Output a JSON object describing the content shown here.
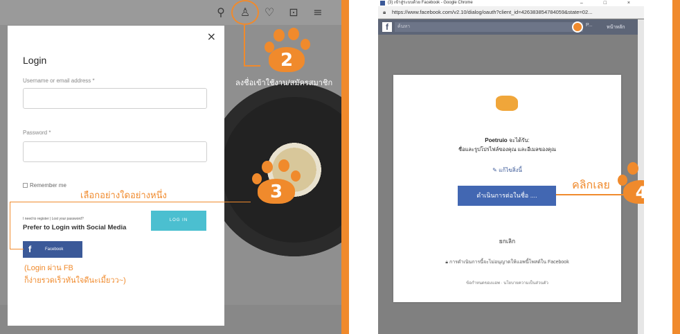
{
  "left": {
    "modal": {
      "close": "×",
      "title": "Login",
      "username_label": "Username or email address *",
      "password_label": "Password *",
      "remember_label": "Remember me",
      "login_button": "LOG IN",
      "small_links": "I need to register | Lost your password?",
      "social_title": "Prefer to Login with Social Media",
      "facebook_label": "Facebook",
      "facebook_letter": "f"
    },
    "nav_icons": [
      "search-icon",
      "user-icon",
      "heart-icon",
      "bag-icon",
      "menu-icon"
    ],
    "annotations": {
      "step2": "2",
      "step2_caption": "ลงชื่อเข้าใช้งาน/สมัครสมาชิก",
      "step3": "3",
      "step3_caption": "เลือกอย่างใดอย่างหนึ่ง",
      "fb_note_1": "(Login ผ่าน FB",
      "fb_note_2": "ก็ง่ายรวดเร็วทันใจดีนะเมี้ยวว~)"
    }
  },
  "right": {
    "window_title": "(3) เข้าสู่ระบบด้วย Facebook - Google Chrome",
    "window_controls": "– □ ×",
    "url": "https://www.facebook.com/v2.10/dialog/oauth?client_id=426383854784059&state=02...",
    "fb_search_placeholder": "ค้นหา",
    "fb_name": "P...",
    "fb_home": "หน้าหลัก",
    "dialog": {
      "app_name": "Poetruio",
      "receive": "จะได้รับ:",
      "permissions": "ชื่อและรูปโปรไฟล์ของคุณ และอีเมลของคุณ",
      "edit": "แก้ไขสิ่งนี้",
      "continue": "ดำเนินการต่อในชื่อ ....",
      "cancel": "ยกเลิก",
      "notice": "การดำเนินการนี้จะไม่อนุญาตให้แอพนี้โพสต์ใน Facebook",
      "policy": "ข้อกำหนดของแอพ · นโยบายความเป็นส่วนตัว"
    },
    "annotations": {
      "step4": "4",
      "step4_caption": "คลิกเลย"
    }
  },
  "colors": {
    "accent": "#f08a2c",
    "facebook": "#3b5998",
    "login_button": "#4bbfd0",
    "continue_button": "#4267b2"
  }
}
